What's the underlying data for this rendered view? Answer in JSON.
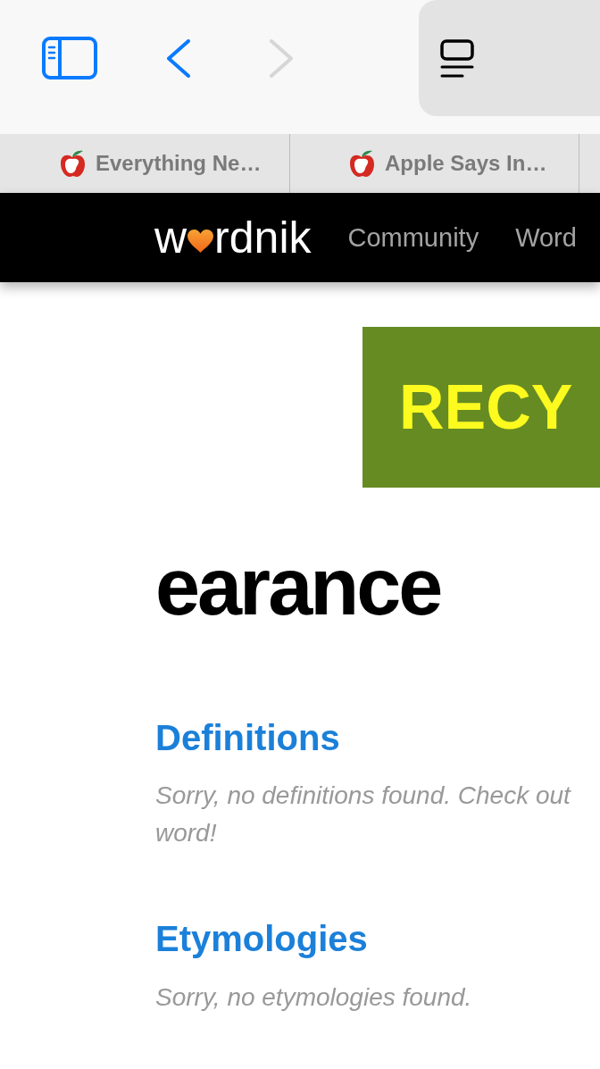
{
  "toolbar": {
    "buttons": [
      {
        "kind": "sidebar",
        "disabled": false
      },
      {
        "kind": "back",
        "disabled": false
      },
      {
        "kind": "forward",
        "disabled": true
      }
    ]
  },
  "tabs": [
    {
      "title": "Everything Ne…",
      "selected": false
    },
    {
      "title": "Apple Says In…",
      "selected": false
    }
  ],
  "site_header": {
    "logo": {
      "start": "w",
      "end": "rdnik"
    },
    "nav": [
      "Community",
      "Word"
    ]
  },
  "ad_banner": {
    "text": "RECY"
  },
  "word": {
    "title": "earance"
  },
  "sections": [
    {
      "heading": "Definitions",
      "message_lines": [
        "Sorry, no definitions found. Check out",
        "word!"
      ]
    },
    {
      "heading": "Etymologies",
      "message_lines": [
        "Sorry, no etymologies found."
      ]
    }
  ]
}
